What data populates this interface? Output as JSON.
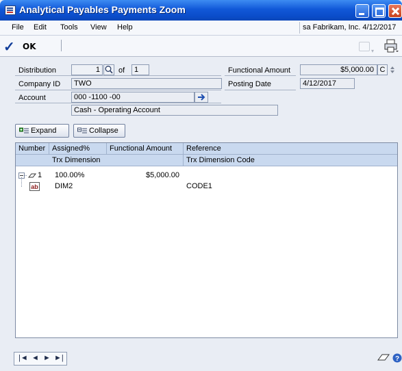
{
  "window": {
    "title": "Analytical Payables Payments Zoom"
  },
  "menu": {
    "items": [
      "File",
      "Edit",
      "Tools",
      "View",
      "Help"
    ],
    "company": "sa  Fabrikam, Inc. 4/12/2017"
  },
  "toolbar": {
    "ok_label": "OK"
  },
  "header": {
    "distribution_label": "Distribution",
    "distribution_value": "1",
    "of_label": "of",
    "of_value": "1",
    "company_id_label": "Company ID",
    "company_id_value": "TWO",
    "account_label": "Account",
    "account_value": "000 -1100 -00",
    "account_description": "Cash - Operating Account",
    "functional_amount_label": "Functional Amount",
    "functional_amount_value": "$5,000.00",
    "currency_button": "C",
    "posting_date_label": "Posting Date",
    "posting_date_value": "4/12/2017"
  },
  "buttons": {
    "expand": "Expand",
    "collapse": "Collapse"
  },
  "grid": {
    "header1": [
      "Number",
      "Assigned%",
      "Functional Amount",
      "Reference"
    ],
    "header2": [
      "Trx Dimension",
      "Trx Dimension Code"
    ],
    "rows": [
      {
        "number": "1",
        "assigned": "100.00%",
        "amount": "$5,000.00",
        "reference": ""
      },
      {
        "dimension": "DIM2",
        "code": "CODE1"
      }
    ],
    "ab_icon_text": "ab"
  }
}
